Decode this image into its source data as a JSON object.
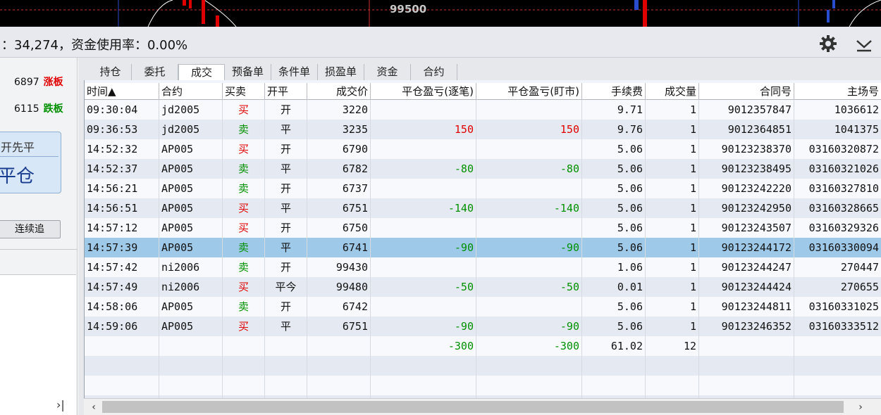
{
  "chart": {
    "price_label": "99500"
  },
  "status": {
    "text": "：34,274，资金使用率：0.00%"
  },
  "icons": {
    "settings": "gear-icon",
    "collapse": "chevron-down-icon",
    "expand": "expand-right-icon"
  },
  "left_panel": {
    "limit_up_value": "6897",
    "limit_up_label": "涨板",
    "limit_down_value": "6115",
    "limit_down_label": "跌板",
    "close_first_title": "开先平",
    "close_first_big": "平仓",
    "chase_button": "连续追",
    "expand_glyph": "›|"
  },
  "tabs": [
    {
      "label": "持仓"
    },
    {
      "label": "委托"
    },
    {
      "label": "成交"
    },
    {
      "label": "预备单"
    },
    {
      "label": "条件单"
    },
    {
      "label": "损盈单"
    },
    {
      "label": "资金"
    },
    {
      "label": "合约"
    }
  ],
  "table": {
    "columns": [
      {
        "label": "时间▲"
      },
      {
        "label": "合约"
      },
      {
        "label": "买卖"
      },
      {
        "label": "开平"
      },
      {
        "label": "成交价"
      },
      {
        "label": "平仓盈亏(逐笔)"
      },
      {
        "label": "平仓盈亏(盯市)"
      },
      {
        "label": "手续费"
      },
      {
        "label": "成交量"
      },
      {
        "label": "合同号"
      },
      {
        "label": "主场号"
      }
    ],
    "rows": [
      {
        "time": "09:30:04",
        "contract": "jd2005",
        "side": "买",
        "offset": "开",
        "price": "3220",
        "pnl_trade": "",
        "pnl_mark": "",
        "fee": "9.71",
        "qty": "1",
        "order_no": "9012357847",
        "main_no": "1036612"
      },
      {
        "time": "09:36:53",
        "contract": "jd2005",
        "side": "卖",
        "offset": "平",
        "price": "3235",
        "pnl_trade": "150",
        "pnl_mark": "150",
        "fee": "9.76",
        "qty": "1",
        "order_no": "9012364851",
        "main_no": "1041375"
      },
      {
        "time": "14:52:32",
        "contract": "AP005",
        "side": "买",
        "offset": "开",
        "price": "6790",
        "pnl_trade": "",
        "pnl_mark": "",
        "fee": "5.06",
        "qty": "1",
        "order_no": "90123238370",
        "main_no": "03160320872"
      },
      {
        "time": "14:52:37",
        "contract": "AP005",
        "side": "卖",
        "offset": "平",
        "price": "6782",
        "pnl_trade": "-80",
        "pnl_mark": "-80",
        "fee": "5.06",
        "qty": "1",
        "order_no": "90123238495",
        "main_no": "03160321026"
      },
      {
        "time": "14:56:21",
        "contract": "AP005",
        "side": "卖",
        "offset": "开",
        "price": "6737",
        "pnl_trade": "",
        "pnl_mark": "",
        "fee": "5.06",
        "qty": "1",
        "order_no": "90123242220",
        "main_no": "03160327810"
      },
      {
        "time": "14:56:51",
        "contract": "AP005",
        "side": "买",
        "offset": "平",
        "price": "6751",
        "pnl_trade": "-140",
        "pnl_mark": "-140",
        "fee": "5.06",
        "qty": "1",
        "order_no": "90123242950",
        "main_no": "03160328665"
      },
      {
        "time": "14:57:12",
        "contract": "AP005",
        "side": "买",
        "offset": "开",
        "price": "6750",
        "pnl_trade": "",
        "pnl_mark": "",
        "fee": "5.06",
        "qty": "1",
        "order_no": "90123243507",
        "main_no": "03160329326"
      },
      {
        "time": "14:57:39",
        "contract": "AP005",
        "side": "卖",
        "offset": "平",
        "price": "6741",
        "pnl_trade": "-90",
        "pnl_mark": "-90",
        "fee": "5.06",
        "qty": "1",
        "order_no": "90123244172",
        "main_no": "03160330094"
      },
      {
        "time": "14:57:42",
        "contract": "ni2006",
        "side": "卖",
        "offset": "开",
        "price": "99430",
        "pnl_trade": "",
        "pnl_mark": "",
        "fee": "1.06",
        "qty": "1",
        "order_no": "90123244247",
        "main_no": "270447"
      },
      {
        "time": "14:57:49",
        "contract": "ni2006",
        "side": "买",
        "offset": "平今",
        "price": "99480",
        "pnl_trade": "-50",
        "pnl_mark": "-50",
        "fee": "0.01",
        "qty": "1",
        "order_no": "90123244424",
        "main_no": "270655"
      },
      {
        "time": "14:58:06",
        "contract": "AP005",
        "side": "卖",
        "offset": "开",
        "price": "6742",
        "pnl_trade": "",
        "pnl_mark": "",
        "fee": "5.06",
        "qty": "1",
        "order_no": "90123244811",
        "main_no": "03160331025"
      },
      {
        "time": "14:59:06",
        "contract": "AP005",
        "side": "买",
        "offset": "平",
        "price": "6751",
        "pnl_trade": "-90",
        "pnl_mark": "-90",
        "fee": "5.06",
        "qty": "1",
        "order_no": "90123246352",
        "main_no": "03160333512"
      }
    ],
    "totals": {
      "pnl_trade": "-300",
      "pnl_mark": "-300",
      "fee": "61.02",
      "qty": "12"
    },
    "selected_index": 7
  },
  "scrollbar": {
    "left_glyph": "‹",
    "right_glyph": "›"
  },
  "colors": {
    "buy": "#e00000",
    "sell": "#009000",
    "selected_row": "#9ec9e8",
    "limit_up": "#e00000",
    "limit_down": "#009000"
  }
}
